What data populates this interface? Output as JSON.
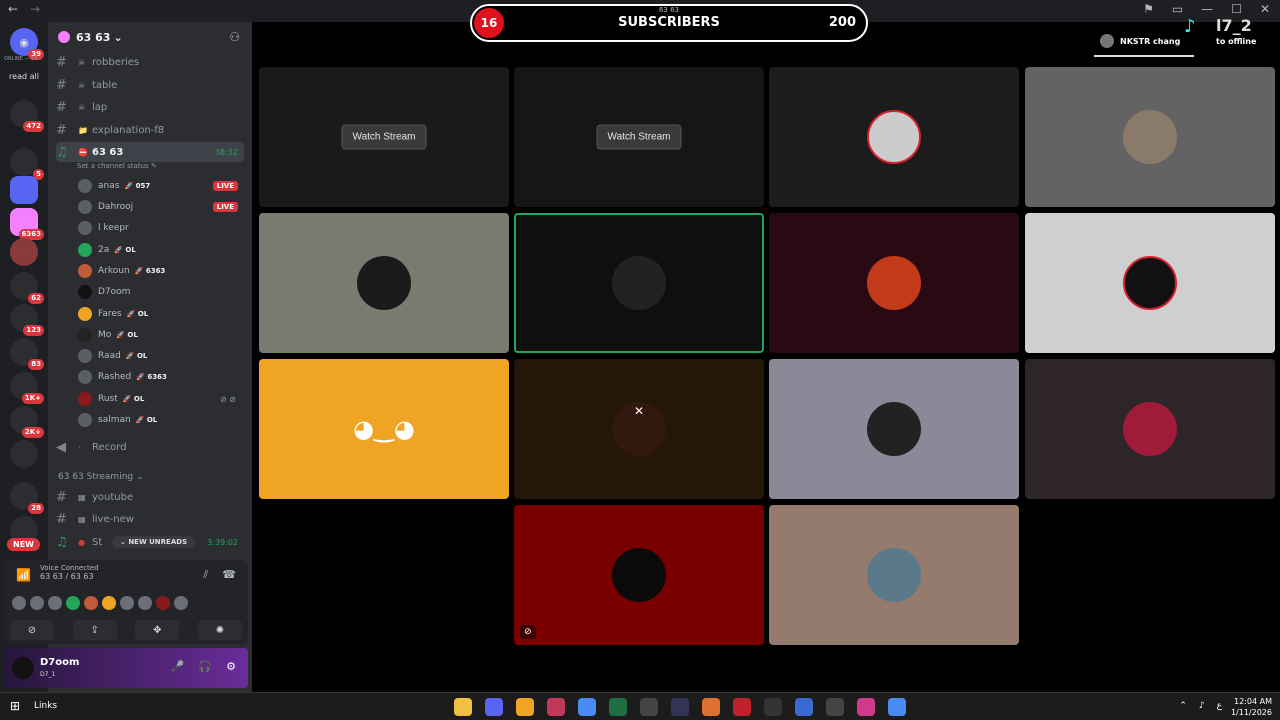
{
  "titlebar": {
    "back": "←",
    "forward": "→",
    "controls": [
      "⚑",
      "▭",
      "—",
      "☐",
      "✕"
    ]
  },
  "servers": {
    "online_text": "ONLINE — 54",
    "read_all": "read all",
    "new_label": "NEW",
    "badges": [
      "39",
      "472",
      "5",
      "6363",
      "62",
      "123",
      "83",
      "1K+",
      "2K+",
      "28"
    ]
  },
  "server_header": {
    "name": "63 63",
    "chevron": "⌄"
  },
  "channels": [
    {
      "name": "robberies",
      "emoji": "☠"
    },
    {
      "name": "table",
      "emoji": "☠"
    },
    {
      "name": "lap",
      "emoji": "☠"
    },
    {
      "name": "explanation-f8",
      "emoji": "📁"
    }
  ],
  "active_voice": {
    "name": "63 63",
    "timer": "38:32",
    "status_hint": "Set a channel status ✎"
  },
  "members": [
    {
      "name": "anas",
      "tag": "🚀 057",
      "live": true
    },
    {
      "name": "Dahrooj",
      "tag": "",
      "live": true
    },
    {
      "name": "l keepr",
      "tag": "",
      "live": false
    },
    {
      "name": "2a",
      "tag": "🚀 OL",
      "live": false
    },
    {
      "name": "Arkoun",
      "tag": "🚀 6363",
      "live": false
    },
    {
      "name": "D7oom",
      "tag": "",
      "live": false
    },
    {
      "name": "Fares",
      "tag": "🚀 OL",
      "live": false
    },
    {
      "name": "Mo",
      "tag": "🚀 OL",
      "live": false
    },
    {
      "name": "Raad",
      "tag": "🚀 OL",
      "live": false
    },
    {
      "name": "Rashed",
      "tag": "🚀 6363",
      "live": false
    },
    {
      "name": "Rust",
      "tag": "🚀 OL",
      "live": false,
      "muted": true
    },
    {
      "name": "salman",
      "tag": "🚀 OL",
      "live": false
    }
  ],
  "live_label": "LIVE",
  "record_channel": "Record",
  "category": "63 63 Streaming",
  "streaming_channels": [
    "youtube",
    "live-new"
  ],
  "stream_voice": {
    "name": "St",
    "timer": "3:39:02"
  },
  "new_unreads": "NEW UNREADS",
  "voice_panel": {
    "status": "Voice Connected",
    "channel": "63 63 / 63 63"
  },
  "user_panel": {
    "name": "D7oom",
    "tag": "D7_1"
  },
  "subscriber_bar": {
    "count": "16",
    "label": "SUBSCRIBERS",
    "goal": "200",
    "mini": "63 63"
  },
  "tiktok": {
    "handle": "l7_2"
  },
  "notification": {
    "name": "NKSTR chang",
    "suffix": "to offline"
  },
  "stage": {
    "watch_label": "Watch Stream",
    "close_mark": "✕"
  },
  "colors": {
    "accent": "#23a55a",
    "live": "#da373c",
    "discord_tile": "#f0a424",
    "sub_red": "#e0101f"
  },
  "taskbar": {
    "links": "Links",
    "time": "12:04 AM",
    "date": "1/11/2026",
    "lang": "ع"
  }
}
